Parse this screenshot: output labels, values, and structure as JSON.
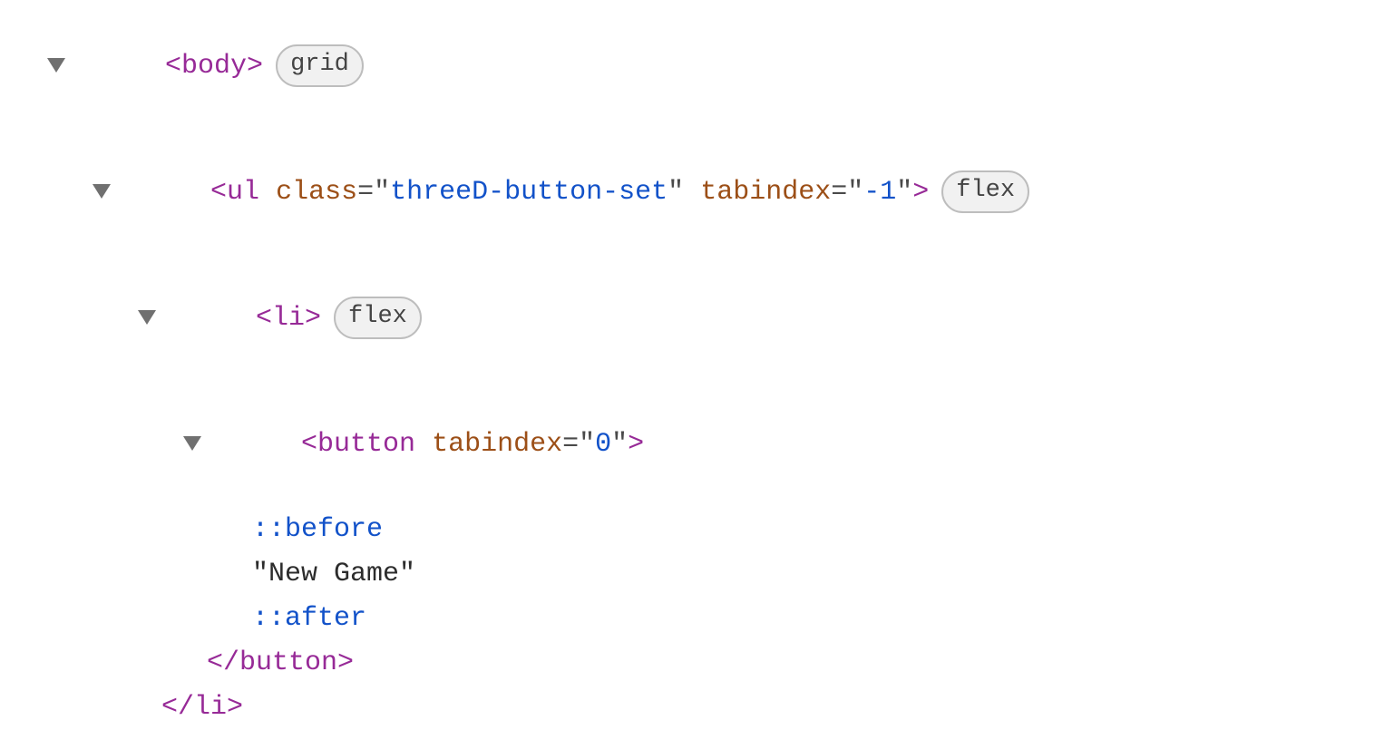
{
  "dom_tree": {
    "lines": [
      {
        "indent": 52,
        "has_triangle": true,
        "segments": [
          {
            "kind": "tag",
            "text": "<body>"
          }
        ],
        "badge": "grid"
      },
      {
        "indent": 102,
        "has_triangle": true,
        "segments": [
          {
            "kind": "tag",
            "text": "<ul"
          },
          {
            "kind": "plain",
            "text": " "
          },
          {
            "kind": "attr-name",
            "text": "class"
          },
          {
            "kind": "attr-eq",
            "text": "=\""
          },
          {
            "kind": "attr-val",
            "text": "threeD-button-set"
          },
          {
            "kind": "attr-eq",
            "text": "\""
          },
          {
            "kind": "plain",
            "text": " "
          },
          {
            "kind": "attr-name",
            "text": "tabindex"
          },
          {
            "kind": "attr-eq",
            "text": "=\""
          },
          {
            "kind": "attr-val",
            "text": "-1"
          },
          {
            "kind": "attr-eq",
            "text": "\""
          },
          {
            "kind": "tag",
            "text": ">"
          }
        ],
        "badge": "flex"
      },
      {
        "indent": 152,
        "has_triangle": true,
        "segments": [
          {
            "kind": "tag",
            "text": "<li>"
          }
        ],
        "badge": "flex"
      },
      {
        "indent": 202,
        "has_triangle": true,
        "segments": [
          {
            "kind": "tag",
            "text": "<button"
          },
          {
            "kind": "plain",
            "text": " "
          },
          {
            "kind": "attr-name",
            "text": "tabindex"
          },
          {
            "kind": "attr-eq",
            "text": "=\""
          },
          {
            "kind": "attr-val",
            "text": "0"
          },
          {
            "kind": "attr-eq",
            "text": "\""
          },
          {
            "kind": "tag",
            "text": ">"
          }
        ],
        "badge": null
      },
      {
        "indent": 278,
        "has_triangle": false,
        "segments": [
          {
            "kind": "pseudo",
            "text": "::before"
          }
        ],
        "badge": null
      },
      {
        "indent": 278,
        "has_triangle": false,
        "segments": [
          {
            "kind": "text-node",
            "text": "\"New Game\""
          }
        ],
        "badge": null
      },
      {
        "indent": 278,
        "has_triangle": false,
        "segments": [
          {
            "kind": "pseudo",
            "text": "::after"
          }
        ],
        "badge": null
      },
      {
        "indent": 228,
        "has_triangle": false,
        "segments": [
          {
            "kind": "tag",
            "text": "</button>"
          }
        ],
        "badge": null
      },
      {
        "indent": 178,
        "has_triangle": false,
        "segments": [
          {
            "kind": "tag",
            "text": "</li>"
          }
        ],
        "badge": null
      }
    ]
  }
}
